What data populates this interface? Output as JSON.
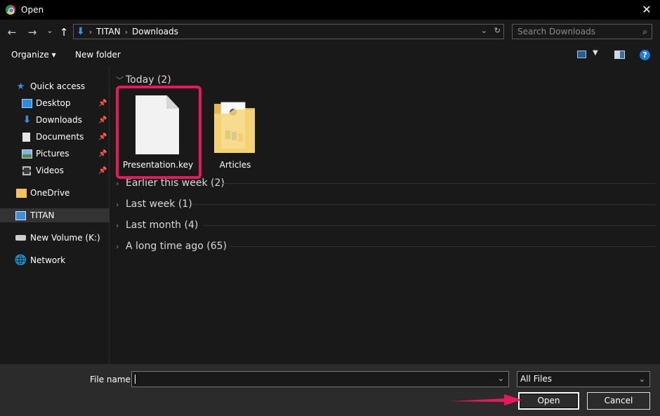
{
  "window": {
    "title": "Open",
    "close_glyph": "✕"
  },
  "nav": {
    "back_glyph": "←",
    "forward_glyph": "→",
    "recent_glyph": "⌄",
    "up_glyph": "↑",
    "breadcrumb": [
      "TITAN",
      "Downloads"
    ],
    "search_placeholder": "Search Downloads"
  },
  "toolbar": {
    "organize": "Organize ▾",
    "new_folder": "New folder",
    "help": "?"
  },
  "sidebar": {
    "items": [
      {
        "label": "Quick access",
        "icon": "star-icon",
        "pinned": false
      },
      {
        "label": "Desktop",
        "icon": "desktop-icon",
        "pinned": true
      },
      {
        "label": "Downloads",
        "icon": "download-icon",
        "pinned": true
      },
      {
        "label": "Documents",
        "icon": "document-icon",
        "pinned": true
      },
      {
        "label": "Pictures",
        "icon": "picture-icon",
        "pinned": true
      },
      {
        "label": "Videos",
        "icon": "video-icon",
        "pinned": true
      },
      {
        "label": "OneDrive",
        "icon": "folder-icon",
        "pinned": false
      },
      {
        "label": "TITAN",
        "icon": "computer-icon",
        "pinned": false,
        "selected": true
      },
      {
        "label": "New Volume (K:)",
        "icon": "drive-icon",
        "pinned": false
      },
      {
        "label": "Network",
        "icon": "network-icon",
        "pinned": false
      }
    ]
  },
  "content": {
    "groups": [
      {
        "label": "Today (2)",
        "expanded": true
      },
      {
        "label": "Earlier this week (2)",
        "expanded": false
      },
      {
        "label": "Last week (1)",
        "expanded": false
      },
      {
        "label": "Last month (4)",
        "expanded": false
      },
      {
        "label": "A long time ago (65)",
        "expanded": false
      }
    ],
    "files": [
      {
        "name": "Presentation.key",
        "icon": "file-icon",
        "highlighted": true
      },
      {
        "name": "Articles",
        "icon": "folder-icon",
        "highlighted": false
      }
    ]
  },
  "footer": {
    "file_name_label": "File name:",
    "file_name_value": "",
    "file_type": "All Files",
    "open_label": "Open",
    "cancel_label": "Cancel"
  },
  "colors": {
    "highlight": "#e8185b",
    "accent": "#3b8ee8"
  }
}
